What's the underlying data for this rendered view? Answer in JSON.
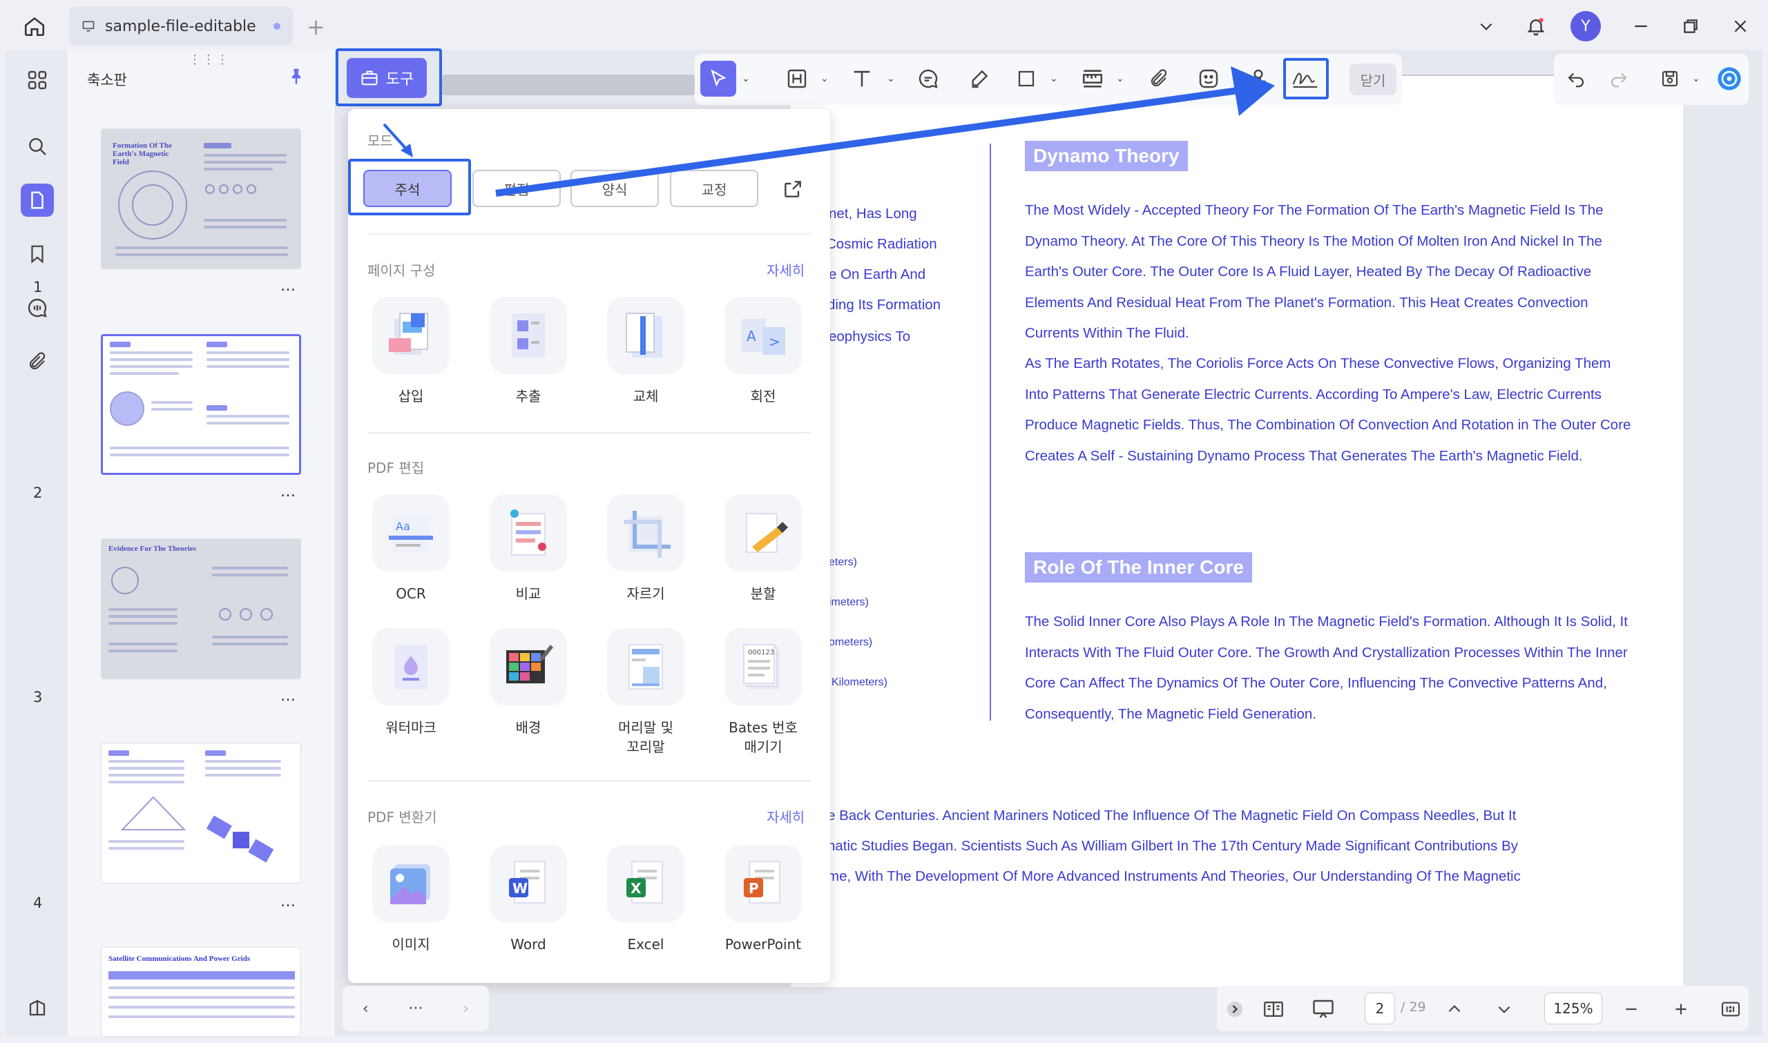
{
  "titlebar": {
    "tab_name": "sample-file-editable",
    "avatar_letter": "Y"
  },
  "sidebar": {
    "title": "축소판"
  },
  "thumbnails": [
    {
      "page": "1",
      "title": "Formation Of The Earth's Magnetic Field"
    },
    {
      "page": "2"
    },
    {
      "page": "3",
      "title": "Evidence For The Theories"
    },
    {
      "page": "4"
    },
    {
      "title": "Satellite Communications And Power Grids"
    }
  ],
  "page_more": "…",
  "toolbar": {
    "tools_label": "도구",
    "close_label": "닫기"
  },
  "panel": {
    "mode_label": "모드",
    "modes": [
      "주석",
      "편집",
      "양식",
      "교정"
    ],
    "section_page": "페이지 구성",
    "section_page_more": "자세히",
    "page_items": [
      "삽입",
      "추출",
      "교체",
      "회전"
    ],
    "section_edit": "PDF 편집",
    "edit_items": [
      "OCR",
      "비교",
      "자르기",
      "분할",
      "워터마크",
      "배경",
      "머리말 및\n꼬리말",
      "Bates 번호\n매기기"
    ],
    "section_convert": "PDF 변환기",
    "section_convert_more": "자세히",
    "convert_items": [
      "이미지",
      "Word",
      "Excel",
      "PowerPoint"
    ]
  },
  "document": {
    "heading1": "Dynamo Theory",
    "para1": "The Most Widely - Accepted Theory For The Formation Of The Earth's Magnetic Field Is The Dynamo Theory. At The Core Of This Theory Is The Motion Of Molten Iron And Nickel In The Earth's Outer Core. The Outer Core Is A Fluid Layer, Heated By The Decay Of Radioactive Elements And Residual Heat From The Planet's Formation. This Heat Creates Convection Currents Within The Fluid.",
    "para2": "As The Earth Rotates, The Coriolis Force Acts On These Convective Flows, Organizing Them Into Patterns That Generate Electric Currents. According To Ampere's Law, Electric Currents Produce Magnetic Fields. Thus, The Combination Of Convection And Rotation in The Outer Core Creates A Self - Sustaining Dynamo Process That Generates The Earth's Magnetic Field.",
    "heading2": "Role Of The Inner Core",
    "para3": "The Solid Inner Core Also Plays A Role In The Magnetic Field's Formation. Although It Is Solid, It Interacts With The Fluid Outer Core. The Growth And Crystallization Processes Within The Inner Core Can Affect The Dynamics Of The Outer Core, Influencing The Convective Patterns And, Consequently, The Magnetic Field Generation.",
    "left_fragments": [
      "net, Has Long",
      "Cosmic Radiation",
      "e On Earth And",
      "ding Its Formation",
      "eophysics To"
    ],
    "small_fragments": [
      "eters)",
      "imeters)",
      "ometers)",
      "Kilometers)"
    ],
    "bottom_lines": [
      "e Back Centuries. Ancient Mariners Noticed The Influence Of The Magnetic Field On Compass Needles, But It",
      "natic Studies Began. Scientists Such As William Gilbert In The 17th Century Made Significant Contributions By",
      "me, With The Development Of More Advanced Instruments And Theories, Our Understanding Of The Magnetic"
    ]
  },
  "bottombar": {
    "nav_more": "···",
    "page_current": "2",
    "page_total": "/ 29",
    "zoom": "125%"
  },
  "colors": {
    "accent": "#6a6cf0",
    "highlight": "#2f64e8",
    "text_blue": "#3a3ad0"
  }
}
